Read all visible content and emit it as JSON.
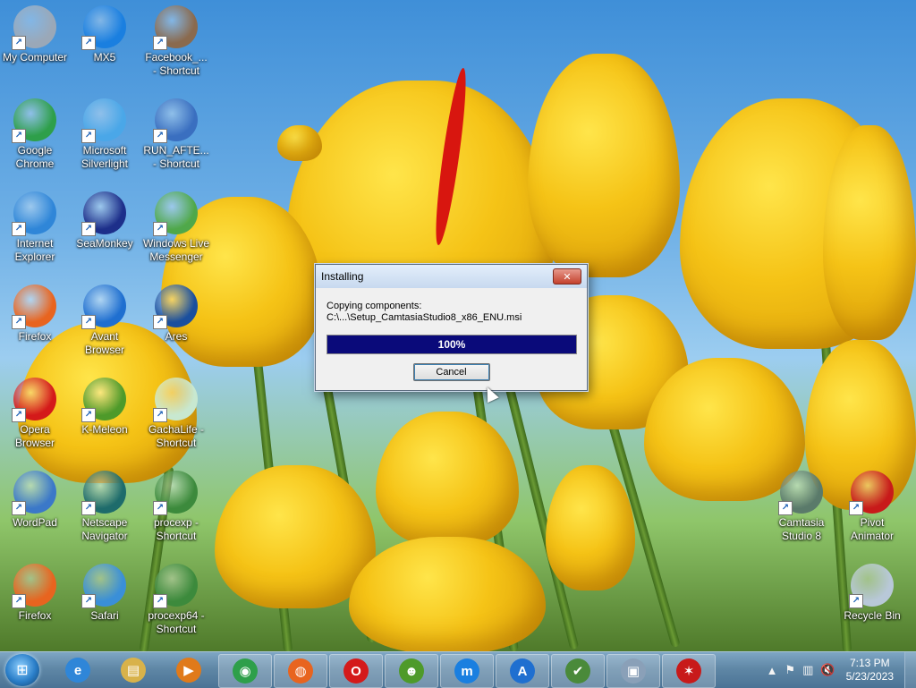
{
  "desktop": {
    "icons": [
      {
        "label": "My Computer",
        "icon": "computer-icon",
        "color": "#9aa8b8"
      },
      {
        "label": "MX5",
        "icon": "maxthon-icon",
        "color": "#1a7fe0"
      },
      {
        "label": "Facebook_...\n- Shortcut",
        "icon": "air-installer-icon",
        "color": "#8a6a4e"
      },
      {
        "label": "Google\nChrome",
        "icon": "chrome-icon",
        "color": "#2e9f4a"
      },
      {
        "label": "Microsoft\nSilverlight",
        "icon": "silverlight-icon",
        "color": "#4aa7e8"
      },
      {
        "label": "RUN_AFTE...\n- Shortcut",
        "icon": "shield-wand-icon",
        "color": "#3a6fc0"
      },
      {
        "label": "Internet\nExplorer",
        "icon": "internet-explorer-icon",
        "color": "#2f86d8"
      },
      {
        "label": "SeaMonkey",
        "icon": "seamonkey-icon",
        "color": "#1d2f8a"
      },
      {
        "label": "Windows Live\nMessenger",
        "icon": "messenger-icon",
        "color": "#4fa84a"
      },
      {
        "label": "Firefox",
        "icon": "firefox-icon",
        "color": "#e8641f"
      },
      {
        "label": "Avant\nBrowser",
        "icon": "avant-icon",
        "color": "#1f6fd0"
      },
      {
        "label": "Ares",
        "icon": "ares-icon",
        "color": "#1a4f9e"
      },
      {
        "label": "Opera\nBrowser",
        "icon": "opera-icon",
        "color": "#d41a1a"
      },
      {
        "label": "K-Meleon",
        "icon": "k-meleon-icon",
        "color": "#4e9a2a"
      },
      {
        "label": "GachaLife -\nShortcut",
        "icon": "gachalife-icon",
        "color": "#c8e8d0"
      },
      {
        "label": "WordPad",
        "icon": "wordpad-icon",
        "color": "#3b78c8"
      },
      {
        "label": "Netscape\nNavigator",
        "icon": "netscape-icon",
        "color": "#1e6b6b"
      },
      {
        "label": "procexp -\nShortcut",
        "icon": "procexp-icon",
        "color": "#3c8a3c"
      },
      {
        "label": "Firefox",
        "icon": "firefox-icon",
        "color": "#e8641f"
      },
      {
        "label": "Safari",
        "icon": "safari-icon",
        "color": "#3a8fd8"
      },
      {
        "label": "procexp64 -\nShortcut",
        "icon": "procexp64-icon",
        "color": "#3c8a3c"
      },
      {
        "label": "Camtasia\nStudio 8",
        "icon": "camtasia-icon",
        "color": "#5a7a6a"
      },
      {
        "label": "Pivot\nAnimator",
        "icon": "pivot-animator-icon",
        "color": "#c81a1a"
      },
      {
        "label": "Recycle Bin",
        "icon": "recycle-bin-icon",
        "color": "#b8c8d8"
      }
    ]
  },
  "dialog": {
    "title": "Installing",
    "close_label": "✕",
    "line1": "Copying components:",
    "line2": "C:\\...\\Setup_CamtasiaStudio8_x86_ENU.msi",
    "progress_value": 100,
    "progress_text": "100%",
    "cancel_label": "Cancel"
  },
  "taskbar": {
    "start_label": "⊞",
    "items": [
      {
        "name": "internet-explorer",
        "glyph": "e",
        "color": "#2f86d8"
      },
      {
        "name": "file-explorer",
        "glyph": "▤",
        "color": "#d8b24a"
      },
      {
        "name": "media-player",
        "glyph": "▶",
        "color": "#e07a1a"
      },
      {
        "name": "chrome",
        "glyph": "◉",
        "color": "#2e9f4a"
      },
      {
        "name": "firefox",
        "glyph": "◍",
        "color": "#e8641f"
      },
      {
        "name": "opera",
        "glyph": "O",
        "color": "#d41a1a"
      },
      {
        "name": "k-meleon",
        "glyph": "☻",
        "color": "#4e9a2a"
      },
      {
        "name": "maxthon",
        "glyph": "m",
        "color": "#1a7fe0"
      },
      {
        "name": "avant",
        "glyph": "A",
        "color": "#1f6fd0"
      },
      {
        "name": "installer",
        "glyph": "✔",
        "color": "#4a8a3a"
      },
      {
        "name": "setup",
        "glyph": "▣",
        "color": "#8aa0b8"
      },
      {
        "name": "pivot-animator",
        "glyph": "✶",
        "color": "#c81a1a"
      }
    ],
    "tray": {
      "chevron": "▲",
      "flag": "⚑",
      "network": "▥",
      "volume": "🔇",
      "time": "7:13 PM",
      "date": "5/23/2023"
    }
  }
}
